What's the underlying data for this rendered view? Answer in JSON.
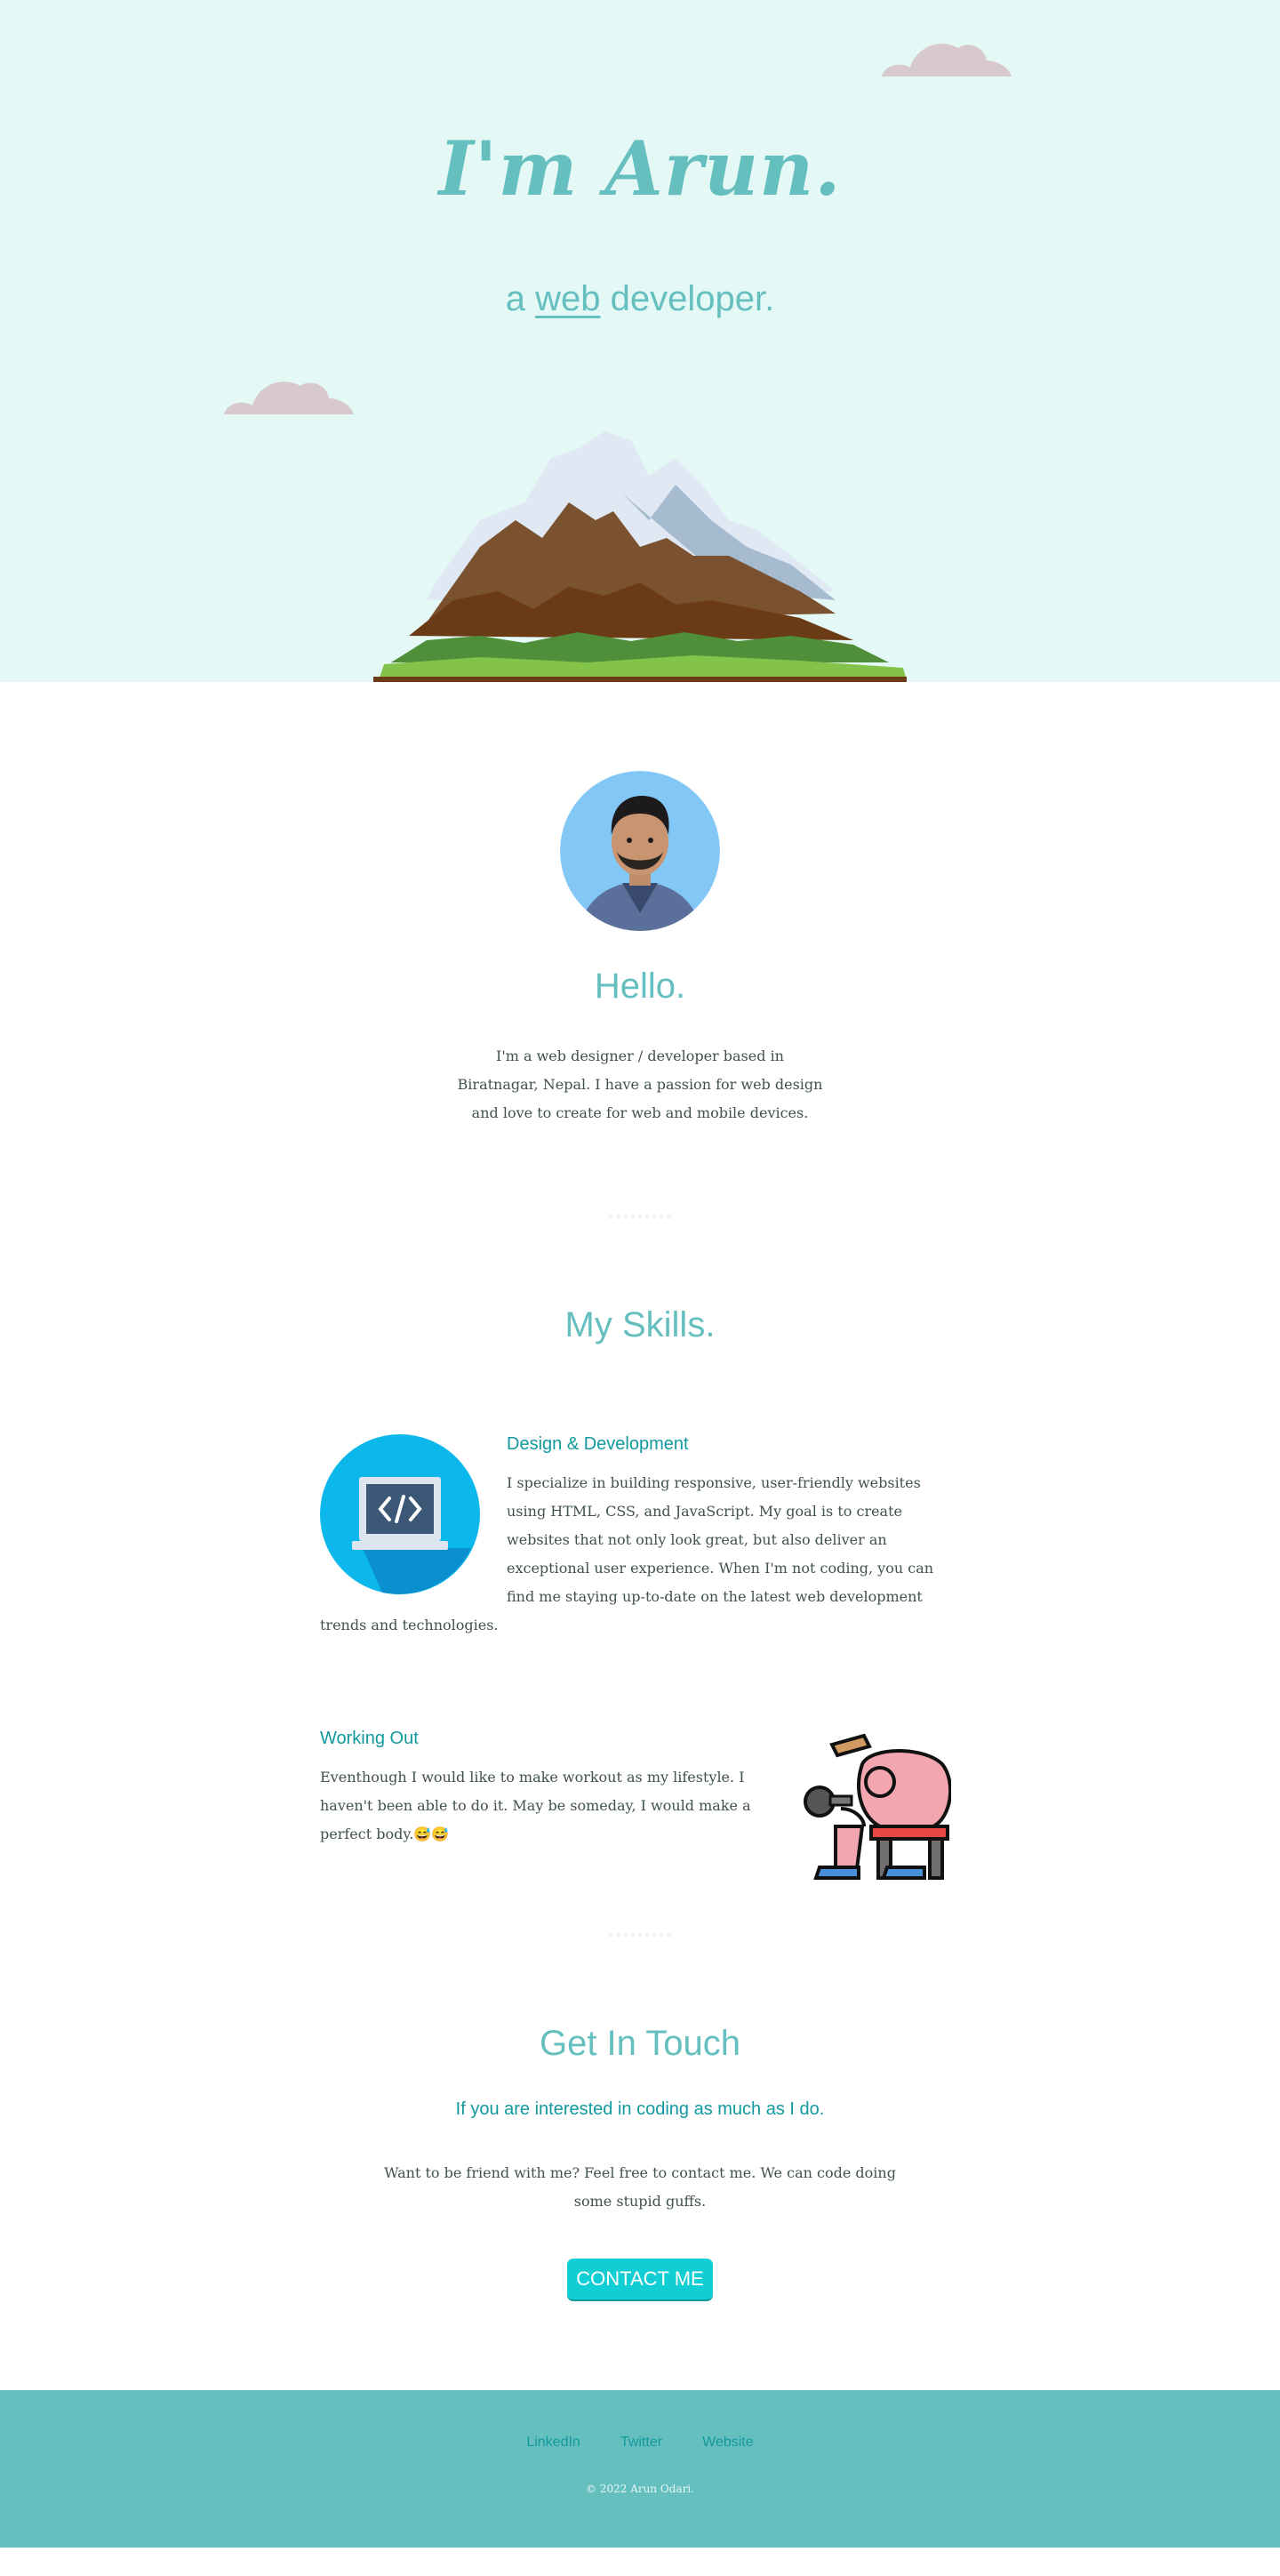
{
  "hero": {
    "title": "I'm Arun.",
    "subtitle_prefix": "a",
    "subtitle_link": "web",
    "subtitle_suffix": "developer."
  },
  "about": {
    "heading": "Hello.",
    "text": "I'm a web designer / developer based in Biratnagar, Nepal. I have a passion for web design and love to create for web and mobile devices."
  },
  "skills": {
    "heading": "My Skills.",
    "items": [
      {
        "title": "Design & Development",
        "text": "I specialize in building responsive, user-friendly websites using HTML, CSS, and JavaScript. My goal is to create websites that not only look great, but also deliver an exceptional user experience. When I'm not coding, you can find me staying up-to-date on the latest web development trends and technologies.",
        "icon": "laptop-code-icon"
      },
      {
        "title": "Working Out",
        "text": "Eventhough I would like to make workout as my lifestyle. I haven't been able to do it. May be someday, I would make a perfect body.😅😅",
        "icon": "workout-icon"
      }
    ]
  },
  "contact": {
    "heading": "Get In Touch",
    "subheading": "If you are interested in coding as much as I do.",
    "text": "Want to be friend with me? Feel free to contact me. We can code doing some stupid guffs.",
    "button_label": "CONTACT ME"
  },
  "footer": {
    "links": [
      "LinkedIn",
      "Twitter",
      "Website"
    ],
    "copyright": "© 2022 Arun Odari."
  },
  "colors": {
    "hero_bg": "#e4f9f5",
    "accent": "#66bfbf",
    "accent_dark": "#11999e",
    "button": "#11cdd4",
    "text": "#40514e"
  }
}
